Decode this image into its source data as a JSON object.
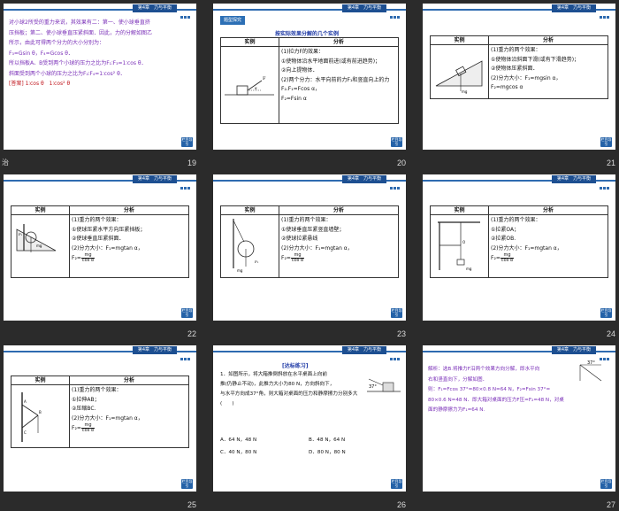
{
  "header_tab": "第4章　力与平衡",
  "footer_button": "栏目导引",
  "side_tag": "治",
  "col_example": "实例",
  "col_analysis": "分析",
  "slide19": {
    "page": "19",
    "lines": [
      "对小球2所受的重力来说，其效果有二：第一、使小球垂直挤",
      "压挡板；第二、使小球垂直压紧斜面．因此，力的分解如图乙",
      "所示，由此可得两个分力的大小分别为：",
      "F₃=Gsin θ，F₄=Gcos θ．",
      "所以挡板A、B受到两个小球的压力之比为F₁∶F₃=1∶cos θ．",
      "斜面受到两个小球的压力之比为F₂∶F₄=1∶cos² θ．"
    ],
    "answer_label": "[答案]",
    "answer": "1∶cos θ　1∶cos² θ"
  },
  "slide20": {
    "page": "20",
    "banner": "题型探究",
    "title": "按实际效果分解的几个实例",
    "lines": [
      "(1)拉力F的效果：",
      "①使物体沿水平地面前进(或有前进趋势)；",
      "②向上提物体．",
      "(2)两个分力：水平向前的力F₁和竖直向上的力",
      "F₂.F₁=Fcos α，",
      "F₂=Fsin α"
    ]
  },
  "slide21": {
    "page": "21",
    "lines": [
      "(1)重力的两个效果：",
      "①使物体沿斜面下滑(或有下滑趋势)；",
      "②使物体压紧斜面．",
      "(2)分力大小：F₁=mgsin α，",
      "F₂=mgcos α"
    ]
  },
  "slide22": {
    "page": "22",
    "lines": [
      "(1)重力的两个效果：",
      "①使球压紧水平方向压紧挡板；",
      "②使球垂直压紧斜面．",
      "(2)分力大小：F₁=mgtan α，"
    ],
    "f2_prefix": "F₂=",
    "f2_num": "mg",
    "f2_den": "cos α"
  },
  "slide23": {
    "page": "23",
    "lines": [
      "(1)重力的两个效果：",
      "①使球垂直压紧竖直墙壁；",
      "②使球拉紧悬线",
      "(2)分力大小：F₁=mgtan α，"
    ],
    "f2_prefix": "F₂=",
    "f2_num": "mg",
    "f2_den": "cos α"
  },
  "slide24": {
    "page": "24",
    "lines": [
      "(1)重力的两个效果：",
      "①拉紧OA；",
      "②拉紧OB.",
      "(2)分力大小：F₁=mgtan α，"
    ],
    "f2_prefix": "F₂=",
    "f2_num": "mg",
    "f2_den": "cos α"
  },
  "slide25": {
    "page": "25",
    "lines": [
      "(1)重力的两个效果：",
      "①拉伸AB；",
      "②压缩BC.",
      "(2)分力大小：F₁=mgtan α，"
    ],
    "f2_prefix": "F₂=",
    "f2_num": "mg",
    "f2_den": "cos α"
  },
  "slide26": {
    "page": "26",
    "heading": "[达标练习]",
    "lines": [
      "1．如图所示，将大箱推倒斜放在水平桌面上向前",
      "推(仍静止不动)，此推力大小为80 N，方向斜向下，",
      "与水平方向成37°角，则大箱对桌面的压力和静摩擦力分别多大",
      "(　　)"
    ],
    "options": [
      "A．64 N，48 N",
      "B．48 N，64 N",
      "C．40 N，80 N",
      "D．80 N，80 N"
    ],
    "fig_label": "37°"
  },
  "slide27": {
    "page": "27",
    "lines": [
      "解析：选B.将推力F沿两个效果方向分解，即水平向",
      "右和竖直向下，分解如图．",
      "则：F₁=Fcos 37°=80×0.8 N=64 N，F₂=Fsin 37°=",
      "80×0.6 N=48 N．即大箱对桌面的压力F压=F₂=48 N，对桌",
      "面的静摩擦力为F₁=64 N."
    ],
    "fig_label": "37°"
  }
}
